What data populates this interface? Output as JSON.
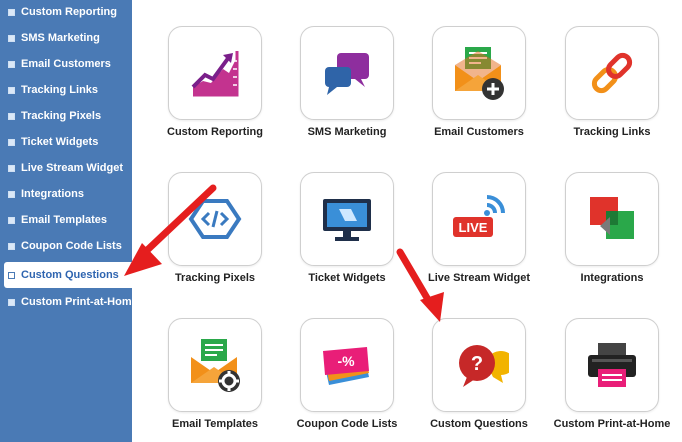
{
  "sidebar": {
    "items": [
      {
        "label": "Custom Reporting"
      },
      {
        "label": "SMS Marketing"
      },
      {
        "label": "Email Customers"
      },
      {
        "label": "Tracking Links"
      },
      {
        "label": "Tracking Pixels"
      },
      {
        "label": "Ticket Widgets"
      },
      {
        "label": "Live Stream Widget"
      },
      {
        "label": "Integrations"
      },
      {
        "label": "Email Templates"
      },
      {
        "label": "Coupon Code Lists"
      },
      {
        "label": "Custom Questions",
        "active": true
      },
      {
        "label": "Custom Print-at-Home"
      }
    ]
  },
  "grid": {
    "tiles": [
      {
        "label": "Custom Reporting",
        "icon": "chart-growth-icon"
      },
      {
        "label": "SMS Marketing",
        "icon": "chat-bubbles-icon"
      },
      {
        "label": "Email Customers",
        "icon": "email-add-icon"
      },
      {
        "label": "Tracking Links",
        "icon": "chain-link-icon"
      },
      {
        "label": "Tracking Pixels",
        "icon": "code-hexagon-icon"
      },
      {
        "label": "Ticket Widgets",
        "icon": "monitor-icon"
      },
      {
        "label": "Live Stream Widget",
        "icon": "live-broadcast-icon"
      },
      {
        "label": "Integrations",
        "icon": "integrations-arrow-icon"
      },
      {
        "label": "Email Templates",
        "icon": "email-gear-icon"
      },
      {
        "label": "Coupon Code Lists",
        "icon": "coupon-percent-icon"
      },
      {
        "label": "Custom Questions",
        "icon": "question-bubble-icon"
      },
      {
        "label": "Custom Print-at-Home",
        "icon": "printer-icon"
      }
    ],
    "live_badge": "LIVE",
    "coupon_badge": "-%"
  },
  "colors": {
    "sidebar": "#4a7ab5",
    "arrow": "#e51e1e",
    "active_text": "#2f65b0"
  }
}
